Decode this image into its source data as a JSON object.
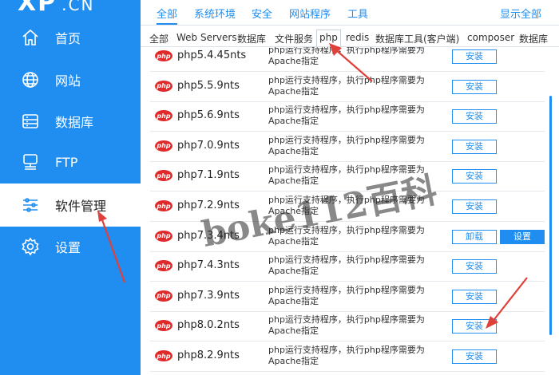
{
  "sidebar": {
    "logo": "XP",
    "logo_suffix": ".CN",
    "items": [
      {
        "label": "首页",
        "icon": "home-icon"
      },
      {
        "label": "网站",
        "icon": "globe-icon"
      },
      {
        "label": "数据库",
        "icon": "database-icon"
      },
      {
        "label": "FTP",
        "icon": "ftp-icon"
      },
      {
        "label": "软件管理",
        "icon": "sliders-icon",
        "active": true
      },
      {
        "label": "设置",
        "icon": "gear-icon"
      }
    ]
  },
  "top_tabs": {
    "items": [
      "全部",
      "系统环境",
      "安全",
      "网站程序",
      "工具"
    ],
    "active": "全部",
    "show_all": "显示全部"
  },
  "sub_tabs": {
    "items": [
      "全部",
      "Web Servers",
      "数据库",
      "文件服务",
      "php",
      "redis",
      "数据库工具(客户端)",
      "composer",
      "数据库"
    ],
    "active": "php"
  },
  "software": [
    {
      "name": "php5.4.45nts",
      "desc": "php运行支持程序，执行php程序需要为Apache指定",
      "action": "安装"
    },
    {
      "name": "php5.5.9nts",
      "desc": "php运行支持程序，执行php程序需要为Apache指定",
      "action": "安装"
    },
    {
      "name": "php5.6.9nts",
      "desc": "php运行支持程序，执行php程序需要为Apache指定",
      "action": "安装"
    },
    {
      "name": "php7.0.9nts",
      "desc": "php运行支持程序，执行php程序需要为Apache指定",
      "action": "安装"
    },
    {
      "name": "php7.1.9nts",
      "desc": "php运行支持程序，执行php程序需要为Apache指定",
      "action": "安装"
    },
    {
      "name": "php7.2.9nts",
      "desc": "php运行支持程序，执行php程序需要为Apache指定",
      "action": "安装"
    },
    {
      "name": "php7.3.4nts",
      "desc": "php运行支持程序，执行php程序需要为Apache指定",
      "action": "卸载",
      "action2": "设置"
    },
    {
      "name": "php7.4.3nts",
      "desc": "php运行支持程序，执行php程序需要为Apache指定",
      "action": "安装"
    },
    {
      "name": "php7.3.9nts",
      "desc": "php运行支持程序，执行php程序需要为Apache指定",
      "action": "安装"
    },
    {
      "name": "php8.0.2nts",
      "desc": "php运行支持程序，执行php程序需要为Apache指定",
      "action": "安装"
    },
    {
      "name": "php8.2.9nts",
      "desc": "php运行支持程序，执行php程序需要为Apache指定",
      "action": "安装"
    }
  ],
  "php_badge": "php",
  "watermark": "boke112百科",
  "colors": {
    "accent": "#1f8ef0",
    "php_red": "#e02a2a",
    "arrow": "#e0403a"
  }
}
